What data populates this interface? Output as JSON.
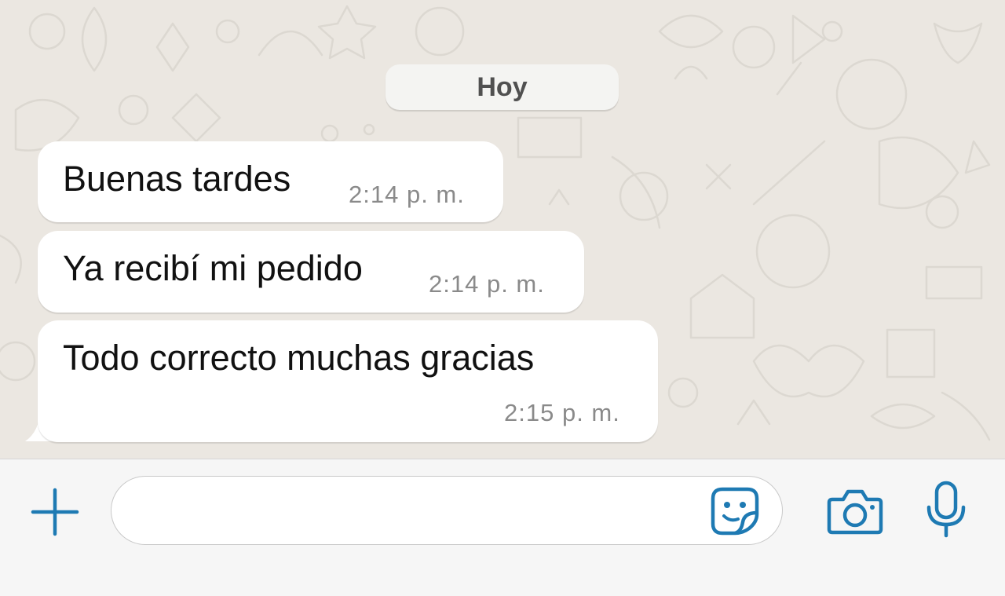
{
  "date_separator": "Hoy",
  "messages": [
    {
      "text": "Buenas tardes",
      "time": "2:14 p. m."
    },
    {
      "text": "Ya recibí mi pedido",
      "time": "2:14 p. m."
    },
    {
      "text": "Todo correcto muchas gracias",
      "time": "2:15 p. m."
    }
  ],
  "input_bar": {
    "message_input_value": "",
    "icons": [
      "plus-icon",
      "sticker-icon",
      "camera-icon",
      "microphone-icon"
    ]
  },
  "colors": {
    "accent": "#1e7ab3",
    "chat_background": "#ebe7e1",
    "bubble": "#ffffff",
    "timestamp": "#8a8a8a"
  }
}
